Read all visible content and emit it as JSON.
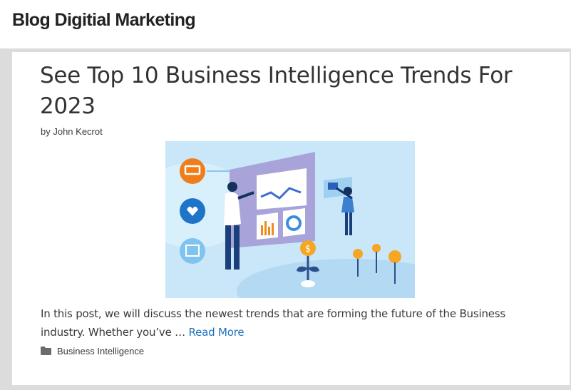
{
  "site": {
    "title": "Blog Digitial Marketing"
  },
  "post": {
    "title": "See Top 10 Business Intelligence Trends For 2023",
    "byline": "by John Kecrot",
    "excerpt": "In this post, we will discuss the newest trends that are forming the future of the Business industry. Whether you’ve … ",
    "read_more": "Read More",
    "category": "Business Intelligence",
    "category_icon": "folder-icon"
  },
  "colors": {
    "link": "#1e73be",
    "page_bg": "#dcdcdc",
    "card_bg": "#ffffff"
  }
}
